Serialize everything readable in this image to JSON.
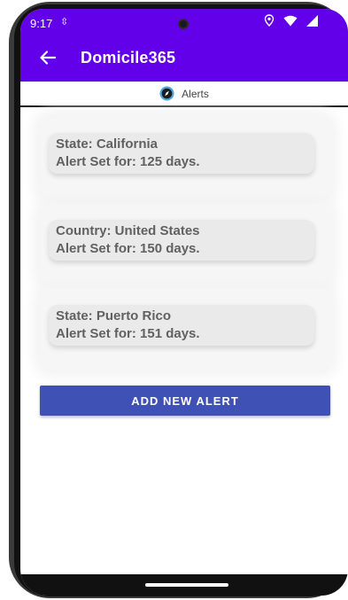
{
  "status_bar": {
    "time": "9:17",
    "sync_glyph": "⇳",
    "icons": [
      "location-icon",
      "wifi-icon",
      "signal-icon"
    ]
  },
  "app_bar": {
    "title": "Domicile365",
    "back_icon": "arrow-left-icon",
    "color": "#6200ea"
  },
  "tab": {
    "label": "Alerts",
    "icon": "compass-icon"
  },
  "alerts": [
    {
      "line1": "State: California",
      "line2": "Alert Set for: 125 days."
    },
    {
      "line1": "Country: United States",
      "line2": "Alert Set for: 150 days."
    },
    {
      "line1": "State: Puerto Rico",
      "line2": "Alert Set for: 151 days."
    }
  ],
  "add_button": {
    "label": "ADD NEW ALERT",
    "color": "#3f51b5"
  }
}
